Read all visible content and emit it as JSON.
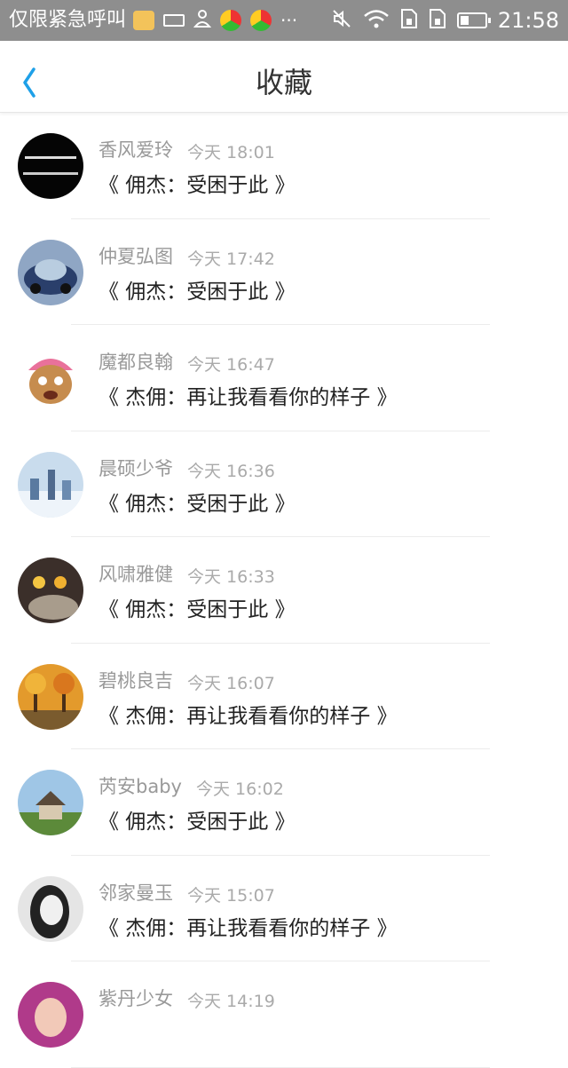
{
  "status_bar": {
    "carrier": "仅限紧急呼叫",
    "overflow": "···",
    "time": "21:58",
    "battery_level": 0.35,
    "icons": [
      "emoji-icon",
      "keyboard-icon",
      "user-icon",
      "app-icon",
      "app-icon",
      "mute-icon",
      "wifi-icon",
      "sim1-icon",
      "sim2-icon",
      "battery-icon"
    ]
  },
  "header": {
    "title": "收藏",
    "back_icon": "chevron-left-icon",
    "accent": "#1ea0e8"
  },
  "favorites": [
    {
      "name": "香风爱玲",
      "time": "今天 18:01",
      "message": "《 佣杰：受困于此 》",
      "avatar": "black-text-avatar"
    },
    {
      "name": "仲夏弘图",
      "time": "今天 17:42",
      "message": "《 佣杰：受困于此 》",
      "avatar": "car-avatar"
    },
    {
      "name": "魔都良翰",
      "time": "今天 16:47",
      "message": "《 杰佣：再让我看看你的样子 》",
      "avatar": "cartoon-avatar"
    },
    {
      "name": "晨硕少爷",
      "time": "今天 16:36",
      "message": "《 佣杰：受困于此 》",
      "avatar": "winter-avatar"
    },
    {
      "name": "风啸雅健",
      "time": "今天 16:33",
      "message": "《 佣杰：受困于此 》",
      "avatar": "lights-avatar"
    },
    {
      "name": "碧桃良吉",
      "time": "今天 16:07",
      "message": "《 杰佣：再让我看看你的样子 》",
      "avatar": "autumn-avatar"
    },
    {
      "name": "芮安baby",
      "time": "今天 16:02",
      "message": "《 佣杰：受困于此 》",
      "avatar": "house-avatar"
    },
    {
      "name": "邻家曼玉",
      "time": "今天 15:07",
      "message": "《 杰佣：再让我看看你的样子 》",
      "avatar": "portrait-avatar"
    },
    {
      "name": "紫丹少女",
      "time": "今天 14:19",
      "message": "",
      "avatar": "pink-avatar"
    }
  ]
}
